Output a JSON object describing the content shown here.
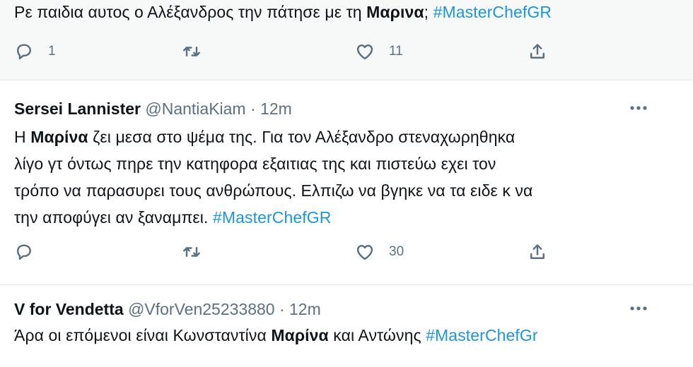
{
  "tweet1": {
    "text_pre": "Ρε παιδια αυτος ο Αλέξανδρος την πάτησε με τη ",
    "text_bold": "Μαρινα",
    "text_post": "; ",
    "hashtag": "#MasterChefGR",
    "reply_count": "1",
    "like_count": "11"
  },
  "tweet2": {
    "name": "Sersei Lannister",
    "handle": "@NantiaKiam",
    "time": "· 12m",
    "line1_pre": "Η ",
    "line1_bold": "Μαρίνα",
    "line1_post": " ζει μεσα στο ψέμα της. Για τον Αλέξανδρο στεναχωρηθηκα",
    "line2": "λίγο γτ όντως πηρε την κατηφορα εξαιτιας της και πιστεύω εχει τον",
    "line3": "τρόπο να παρασυρει τους ανθρώπους. Ελπιζω να βγηκε να τα ειδε κ να",
    "line4_pre": "την αποφύγει αν ξαναμπει. ",
    "hashtag": "#MasterChefGR",
    "like_count": "30"
  },
  "tweet3": {
    "name": "V for Vendetta",
    "handle": "@VforVen25233880",
    "time": "· 12m",
    "text_pre": "Άρα οι επόμενοι είναι Κωνσταντίνα ",
    "text_bold": "Μαρίνα",
    "text_post": " και Αντώνης ",
    "hashtag": "#MasterChefGr"
  },
  "icons": {
    "reply": "reply-icon",
    "retweet": "retweet-icon",
    "like": "heart-icon",
    "share": "share-icon",
    "more": "more-icon"
  },
  "colors": {
    "hashtag": "#1b95e0",
    "secondary": "#5b7083",
    "text": "#0f1419",
    "highlight_bg": "#f7f9f9",
    "separator": "#e1e8ed"
  }
}
